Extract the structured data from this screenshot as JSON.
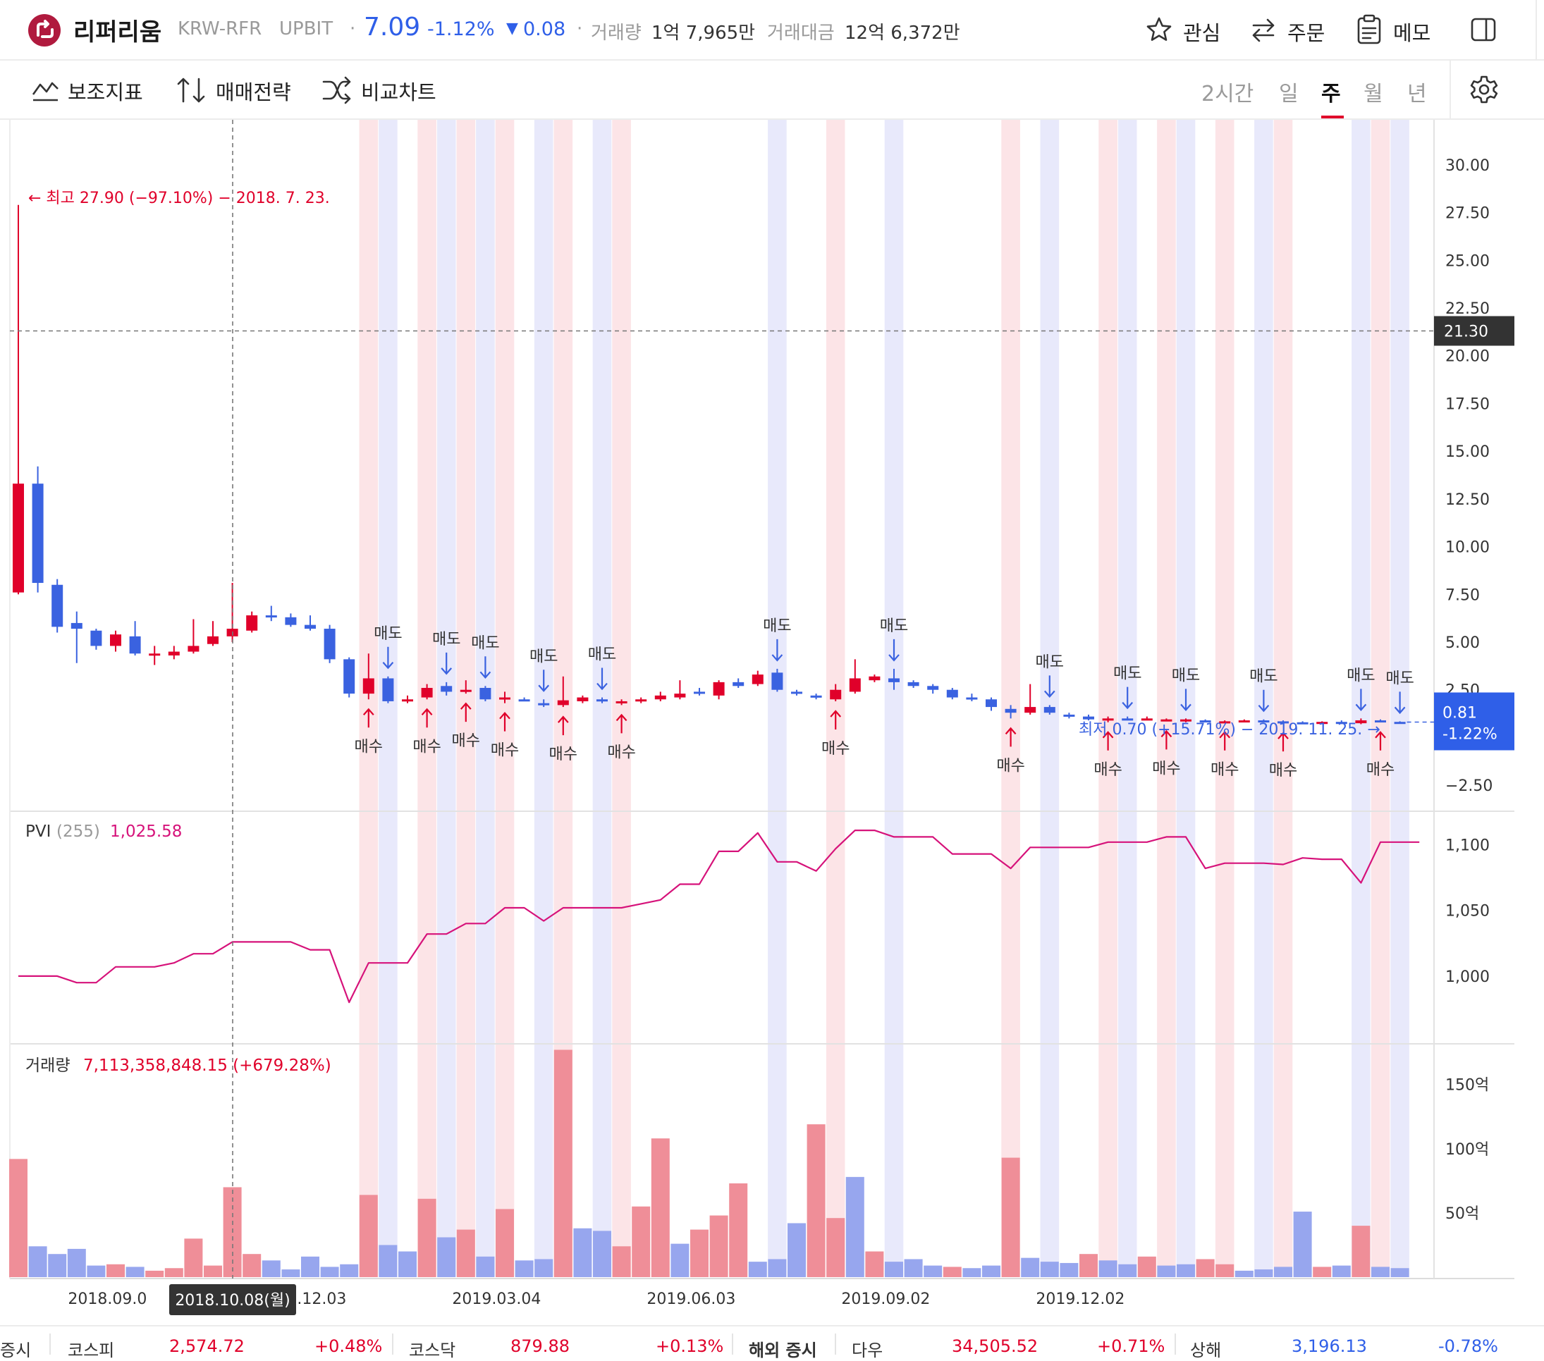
{
  "header": {
    "coin_name": "리퍼리움",
    "market_code": "KRW-RFR",
    "exchange": "UPBIT",
    "separator": "·",
    "price": "7.09",
    "change_pct": "-1.12%",
    "change_arrow": "▼",
    "change_abs": "0.08",
    "volume_label": "거래량",
    "volume_value": "1억 7,965만",
    "amount_label": "거래대금",
    "amount_value": "12억 6,372만",
    "watch_label": "관심",
    "order_label": "주문",
    "memo_label": "메모",
    "icons": {
      "logo": "upbit-logo-icon",
      "watch": "star-icon",
      "order": "swap-arrows-icon",
      "memo": "clipboard-icon",
      "panel": "side-panel-icon"
    }
  },
  "toolbar": {
    "indicator_label": "보조지표",
    "strategy_label": "매매전략",
    "compare_label": "비교차트",
    "intervals": [
      "2시간",
      "일",
      "주",
      "월",
      "년"
    ],
    "active_interval": "주",
    "icons": {
      "indicator": "indicator-chart-icon",
      "strategy": "up-down-arrows-icon",
      "compare": "shuffle-icon",
      "settings": "gear-icon"
    }
  },
  "colors": {
    "up": "#e0002a",
    "down": "#3a62e0",
    "buy_band": "#fce4e7",
    "sell_band": "#e8e9fb",
    "pvi_line": "#d6127a",
    "up_volume": "#ef8e98",
    "down_volume": "#97a6ee",
    "grid": "#ebebeb",
    "accent_red": "#e0002a",
    "accent_blue": "#2f5fe8"
  },
  "chart_data": [
    {
      "type": "candlestick",
      "panel": "price",
      "ylim": [
        -3.75,
        31.25
      ],
      "yticks": [
        "30.00",
        "27.50",
        "25.00",
        "22.50",
        "20.00",
        "17.50",
        "15.00",
        "12.50",
        "10.00",
        "7.50",
        "5.00",
        "2.50",
        "-2.50"
      ],
      "crosshair_value": "21.30",
      "current_value": "0.81",
      "current_change": "-1.22%",
      "high_annotation": "← 최고 27.90 (−97.10%) − 2018. 7. 23.",
      "low_annotation": "최저 0.70 (+15.71%) − 2019. 11. 25. →",
      "candles": [
        {
          "o": 7.6,
          "h": 27.9,
          "l": 7.5,
          "c": 13.3
        },
        {
          "o": 13.3,
          "h": 14.2,
          "l": 7.6,
          "c": 8.1
        },
        {
          "o": 8.0,
          "h": 8.3,
          "l": 5.5,
          "c": 5.8
        },
        {
          "o": 6.0,
          "h": 6.6,
          "l": 3.9,
          "c": 5.7
        },
        {
          "o": 5.6,
          "h": 5.7,
          "l": 4.6,
          "c": 4.8
        },
        {
          "o": 4.8,
          "h": 5.6,
          "l": 4.5,
          "c": 5.4
        },
        {
          "o": 5.3,
          "h": 6.1,
          "l": 4.3,
          "c": 4.4
        },
        {
          "o": 4.3,
          "h": 4.8,
          "l": 3.8,
          "c": 4.4
        },
        {
          "o": 4.3,
          "h": 4.8,
          "l": 4.1,
          "c": 4.5
        },
        {
          "o": 4.5,
          "h": 6.2,
          "l": 4.4,
          "c": 4.8
        },
        {
          "o": 4.9,
          "h": 6.1,
          "l": 4.8,
          "c": 5.3
        },
        {
          "o": 5.3,
          "h": 8.1,
          "l": 5.0,
          "c": 5.7
        },
        {
          "o": 5.6,
          "h": 6.6,
          "l": 5.5,
          "c": 6.4
        },
        {
          "o": 6.4,
          "h": 6.9,
          "l": 6.1,
          "c": 6.3
        },
        {
          "o": 6.3,
          "h": 6.5,
          "l": 5.8,
          "c": 5.9
        },
        {
          "o": 5.9,
          "h": 6.4,
          "l": 5.6,
          "c": 5.7
        },
        {
          "o": 5.7,
          "h": 5.9,
          "l": 3.9,
          "c": 4.1
        },
        {
          "o": 4.1,
          "h": 4.2,
          "l": 2.1,
          "c": 2.3
        },
        {
          "o": 2.3,
          "h": 4.4,
          "l": 2.0,
          "c": 3.1
        },
        {
          "o": 3.1,
          "h": 3.2,
          "l": 1.8,
          "c": 1.9
        },
        {
          "o": 1.9,
          "h": 2.2,
          "l": 1.8,
          "c": 2.0
        },
        {
          "o": 2.1,
          "h": 2.8,
          "l": 2.0,
          "c": 2.6
        },
        {
          "o": 2.7,
          "h": 2.9,
          "l": 2.2,
          "c": 2.4
        },
        {
          "o": 2.4,
          "h": 3.0,
          "l": 2.3,
          "c": 2.5
        },
        {
          "o": 2.6,
          "h": 2.7,
          "l": 1.9,
          "c": 2.0
        },
        {
          "o": 2.0,
          "h": 2.4,
          "l": 1.8,
          "c": 2.1
        },
        {
          "o": 2.0,
          "h": 2.1,
          "l": 1.9,
          "c": 1.95
        },
        {
          "o": 1.8,
          "h": 2.0,
          "l": 1.6,
          "c": 1.7
        },
        {
          "o": 1.7,
          "h": 3.2,
          "l": 1.6,
          "c": 1.95
        },
        {
          "o": 1.9,
          "h": 2.2,
          "l": 1.8,
          "c": 2.1
        },
        {
          "o": 2.0,
          "h": 2.1,
          "l": 1.8,
          "c": 1.9
        },
        {
          "o": 1.8,
          "h": 2.0,
          "l": 1.7,
          "c": 1.9
        },
        {
          "o": 1.9,
          "h": 2.1,
          "l": 1.8,
          "c": 2.0
        },
        {
          "o": 2.0,
          "h": 2.4,
          "l": 1.9,
          "c": 2.2
        },
        {
          "o": 2.1,
          "h": 3.0,
          "l": 2.0,
          "c": 2.3
        },
        {
          "o": 2.4,
          "h": 2.6,
          "l": 2.2,
          "c": 2.3
        },
        {
          "o": 2.2,
          "h": 3.0,
          "l": 2.0,
          "c": 2.9
        },
        {
          "o": 2.9,
          "h": 3.1,
          "l": 2.6,
          "c": 2.7
        },
        {
          "o": 2.8,
          "h": 3.5,
          "l": 2.7,
          "c": 3.3
        },
        {
          "o": 3.4,
          "h": 3.6,
          "l": 2.4,
          "c": 2.5
        },
        {
          "o": 2.4,
          "h": 2.5,
          "l": 2.2,
          "c": 2.3
        },
        {
          "o": 2.2,
          "h": 2.3,
          "l": 2.0,
          "c": 2.1
        },
        {
          "o": 2.0,
          "h": 2.8,
          "l": 1.9,
          "c": 2.5
        },
        {
          "o": 2.4,
          "h": 4.1,
          "l": 2.3,
          "c": 3.1
        },
        {
          "o": 3.0,
          "h": 3.3,
          "l": 2.9,
          "c": 3.2
        },
        {
          "o": 3.1,
          "h": 3.6,
          "l": 2.5,
          "c": 2.9
        },
        {
          "o": 2.9,
          "h": 3.0,
          "l": 2.6,
          "c": 2.7
        },
        {
          "o": 2.7,
          "h": 2.8,
          "l": 2.3,
          "c": 2.5
        },
        {
          "o": 2.5,
          "h": 2.6,
          "l": 2.0,
          "c": 2.1
        },
        {
          "o": 2.1,
          "h": 2.3,
          "l": 1.9,
          "c": 2.0
        },
        {
          "o": 2.0,
          "h": 2.1,
          "l": 1.4,
          "c": 1.6
        },
        {
          "o": 1.5,
          "h": 1.7,
          "l": 1.0,
          "c": 1.3
        },
        {
          "o": 1.3,
          "h": 2.8,
          "l": 1.2,
          "c": 1.6
        },
        {
          "o": 1.6,
          "h": 1.7,
          "l": 1.2,
          "c": 1.3
        },
        {
          "o": 1.2,
          "h": 1.3,
          "l": 1.0,
          "c": 1.1
        },
        {
          "o": 1.1,
          "h": 1.2,
          "l": 0.9,
          "c": 0.95
        },
        {
          "o": 0.9,
          "h": 1.1,
          "l": 0.8,
          "c": 1.0
        },
        {
          "o": 1.0,
          "h": 1.1,
          "l": 0.9,
          "c": 0.95
        },
        {
          "o": 0.95,
          "h": 1.1,
          "l": 0.9,
          "c": 1.0
        },
        {
          "o": 0.9,
          "h": 1.0,
          "l": 0.85,
          "c": 0.95
        },
        {
          "o": 0.9,
          "h": 1.0,
          "l": 0.8,
          "c": 0.95
        },
        {
          "o": 0.9,
          "h": 0.95,
          "l": 0.8,
          "c": 0.85
        },
        {
          "o": 0.85,
          "h": 0.9,
          "l": 0.8,
          "c": 0.85
        },
        {
          "o": 0.85,
          "h": 0.95,
          "l": 0.8,
          "c": 0.9
        },
        {
          "o": 0.9,
          "h": 0.95,
          "l": 0.8,
          "c": 0.85
        },
        {
          "o": 0.85,
          "h": 0.9,
          "l": 0.75,
          "c": 0.8
        },
        {
          "o": 0.8,
          "h": 0.85,
          "l": 0.7,
          "c": 0.75
        },
        {
          "o": 0.8,
          "h": 0.85,
          "l": 0.75,
          "c": 0.82
        },
        {
          "o": 0.82,
          "h": 0.9,
          "l": 0.75,
          "c": 0.78
        },
        {
          "o": 0.75,
          "h": 1.0,
          "l": 0.7,
          "c": 0.9
        },
        {
          "o": 0.9,
          "h": 0.95,
          "l": 0.8,
          "c": 0.82
        },
        {
          "o": 0.82,
          "h": 0.85,
          "l": 0.78,
          "c": 0.81
        }
      ],
      "signals": [
        {
          "type": "buy",
          "index": 18,
          "label": "매수"
        },
        {
          "type": "sell",
          "index": 19,
          "label": "매도"
        },
        {
          "type": "buy",
          "index": 21,
          "label": "매수"
        },
        {
          "type": "sell",
          "index": 22,
          "label": "매도"
        },
        {
          "type": "buy",
          "index": 23,
          "label": "매수"
        },
        {
          "type": "sell",
          "index": 24,
          "label": "매도"
        },
        {
          "type": "buy",
          "index": 25,
          "label": "매수"
        },
        {
          "type": "sell",
          "index": 27,
          "label": "매도"
        },
        {
          "type": "buy",
          "index": 28,
          "label": "매수"
        },
        {
          "type": "sell",
          "index": 30,
          "label": "매도"
        },
        {
          "type": "buy",
          "index": 31,
          "label": "매수"
        },
        {
          "type": "sell",
          "index": 39,
          "label": "매도"
        },
        {
          "type": "buy",
          "index": 42,
          "label": "매수"
        },
        {
          "type": "sell",
          "index": 45,
          "label": "매도"
        },
        {
          "type": "buy",
          "index": 51,
          "label": "매수"
        },
        {
          "type": "sell",
          "index": 53,
          "label": "매도"
        },
        {
          "type": "buy",
          "index": 56,
          "label": "매수"
        },
        {
          "type": "sell",
          "index": 57,
          "label": "매도"
        },
        {
          "type": "buy",
          "index": 59,
          "label": "매수"
        },
        {
          "type": "sell",
          "index": 60,
          "label": "매도"
        },
        {
          "type": "buy",
          "index": 62,
          "label": "매수"
        },
        {
          "type": "sell",
          "index": 64,
          "label": "매도"
        },
        {
          "type": "buy",
          "index": 65,
          "label": "매수"
        },
        {
          "type": "sell",
          "index": 69,
          "label": "매도"
        },
        {
          "type": "buy",
          "index": 70,
          "label": "매수"
        },
        {
          "type": "sell",
          "index": 71,
          "label": "매도"
        }
      ]
    },
    {
      "type": "line",
      "panel": "indicator",
      "name": "PVI",
      "param": "(255)",
      "last_value": "1,025.58",
      "ylim": [
        950,
        1125
      ],
      "yticks": [
        "1,100",
        "1,050",
        "1,000"
      ],
      "values": [
        1000,
        1000,
        1000,
        995,
        995,
        1007,
        1007,
        1007,
        1010,
        1017,
        1017,
        1026,
        1026,
        1026,
        1026,
        1020,
        1020,
        980,
        1010,
        1010,
        1010,
        1032,
        1032,
        1040,
        1040,
        1052,
        1052,
        1042,
        1052,
        1052,
        1052,
        1052,
        1055,
        1058,
        1070,
        1070,
        1095,
        1095,
        1109,
        1087,
        1087,
        1080,
        1097,
        1111,
        1111,
        1106,
        1106,
        1106,
        1093,
        1093,
        1093,
        1082,
        1098,
        1098,
        1098,
        1098,
        1102,
        1102,
        1102,
        1106,
        1106,
        1082,
        1086,
        1086,
        1086,
        1085,
        1090,
        1089,
        1089,
        1071,
        1102,
        1102,
        1102
      ]
    },
    {
      "type": "bar",
      "panel": "volume",
      "name": "거래량",
      "last_value": "7,113,358,848.15 (+679.28%)",
      "unit": "억",
      "ylim": [
        0,
        180
      ],
      "yticks": [
        "150억",
        "100억",
        "50억"
      ],
      "values": [
        92,
        24,
        18,
        22,
        9,
        10,
        8,
        5,
        7,
        30,
        9,
        70,
        18,
        13,
        6,
        16,
        8,
        10,
        64,
        25,
        20,
        61,
        31,
        37,
        16,
        53,
        13,
        14,
        177,
        38,
        36,
        24,
        55,
        108,
        26,
        37,
        48,
        73,
        12,
        14,
        42,
        119,
        46,
        78,
        20,
        12,
        14,
        9,
        8,
        7,
        9,
        93,
        15,
        12,
        11,
        18,
        13,
        10,
        16,
        9,
        10,
        14,
        10,
        5,
        6,
        8,
        51,
        8,
        9,
        40,
        8,
        7
      ],
      "directions": [
        "up",
        "down",
        "down",
        "down",
        "down",
        "up",
        "down",
        "up",
        "up",
        "up",
        "up",
        "up",
        "up",
        "down",
        "down",
        "down",
        "down",
        "down",
        "up",
        "down",
        "down",
        "up",
        "down",
        "up",
        "down",
        "up",
        "down",
        "down",
        "up",
        "down",
        "down",
        "up",
        "up",
        "up",
        "down",
        "up",
        "up",
        "up",
        "down",
        "down",
        "down",
        "up",
        "up",
        "down",
        "up",
        "down",
        "down",
        "down",
        "up",
        "down",
        "down",
        "up",
        "down",
        "down",
        "down",
        "up",
        "down",
        "down",
        "up",
        "down",
        "down",
        "up",
        "up",
        "down",
        "down",
        "down",
        "down",
        "up",
        "down",
        "up",
        "down",
        "down"
      ],
      "xticks": [
        "2018.09.0",
        "2018.12.03",
        "2019.03.04",
        "2019.06.03",
        "2019.09.02",
        "2019.12.02"
      ],
      "crosshair_date": "2018.10.08(월)"
    }
  ],
  "ticker": {
    "market_label": "증시",
    "items": [
      {
        "name": "코스피",
        "value": "2,574.72",
        "change": "+0.48%"
      },
      {
        "name": "코스닥",
        "value": "879.88",
        "change": "+0.13%"
      },
      {
        "name": "해외 증시",
        "value": "",
        "change": ""
      },
      {
        "name": "다우",
        "value": "34,505.52",
        "change": "+0.71%"
      },
      {
        "name": "상해",
        "value": "3,196.13",
        "change": "-0.78%"
      }
    ]
  }
}
